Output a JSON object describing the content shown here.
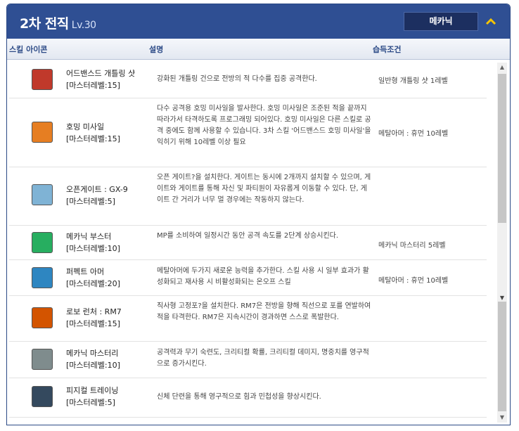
{
  "header": {
    "title": "2차 전직",
    "level": "Lv.30",
    "job_button": "메카닉"
  },
  "columns": {
    "icon": "스킬 아이콘",
    "desc": "설명",
    "cond": "습득조건"
  },
  "skills": [
    {
      "name": "어드밴스드 개틀링 샷",
      "master": "[마스터레벨:15]",
      "desc": "강화된 개틀링 건으로 전방의 적 다수를 집중 공격한다.",
      "cond": "일반형 개틀링 샷 1레벨",
      "icon_color": "#c0392b"
    },
    {
      "name": "호밍 미사일",
      "master": "[마스터레벨:15]",
      "desc": "다수 공격용 호밍 미사일을 발사한다. 호밍 미사일은 조준된 적을 끝까지 따라가서 타격하도록 프로그래밍 되어있다. 호밍 미사일은 다른 스킬로 공격 중에도 함께 사용할 수 있습니다. 3차 스킬 '어드밴스드 호밍 미사일'을 익히기 위해 10레벨 이상 필요",
      "cond": "메탈아머 : 휴먼 10레벨",
      "icon_color": "#e67e22"
    },
    {
      "name": "오픈게이트 : GX-9",
      "master": "[마스터레벨:5]",
      "desc": "오픈 게이트?을 설치한다. 게이트는 동시에 2개까지 설치할 수 있으며, 게이트와 게이트를 통해 자신 및 파티원이 자유롭게 이동할 수 있다. 단, 게이트 간 거리가 너무 멀 경우에는 작동하지 않는다.",
      "cond": "",
      "icon_color": "#7fb3d5"
    },
    {
      "name": "메카닉 부스터",
      "master": "[마스터레벨:10]",
      "desc": "MP를 소비하여 일정시간 동안 공격 속도를 2단계 상승시킨다.",
      "cond": "메카닉 마스터리 5레벨",
      "icon_color": "#27ae60"
    },
    {
      "name": "퍼펙트 아머",
      "master": "[마스터레벨:20]",
      "desc": "메탈아머에 두가지 새로운 능력을 추가한다. 스킬 사용 시 일부 효과가 활성화되고 재사용 시 비활성화되는 온오프 스킬",
      "cond": "메탈아머 : 휴먼 10레벨",
      "icon_color": "#2e86c1"
    },
    {
      "name": "로보 런처 : RM7",
      "master": "[마스터레벨:15]",
      "desc": "직사형 고정포?을 설치한다. RM7은 전방을 향해 직선으로 포를 연발하여 적을 타격한다. RM7은 지속시간이 경과하면 스스로 폭발한다.",
      "cond": "",
      "icon_color": "#d35400"
    },
    {
      "name": "메카닉 마스터리",
      "master": "[마스터레벨:10]",
      "desc": "공격력과 무기 숙련도, 크리티컬 확률, 크리티컬 데미지, 명중치를 영구적으로 증가시킨다.",
      "cond": "",
      "icon_color": "#7f8c8d"
    },
    {
      "name": "피지컬 트레이닝",
      "master": "[마스터레벨:5]",
      "desc": "신체 단련을 통해 영구적으로 힘과 민첩성을 향상시킨다.",
      "cond": "",
      "icon_color": "#34495e"
    }
  ]
}
